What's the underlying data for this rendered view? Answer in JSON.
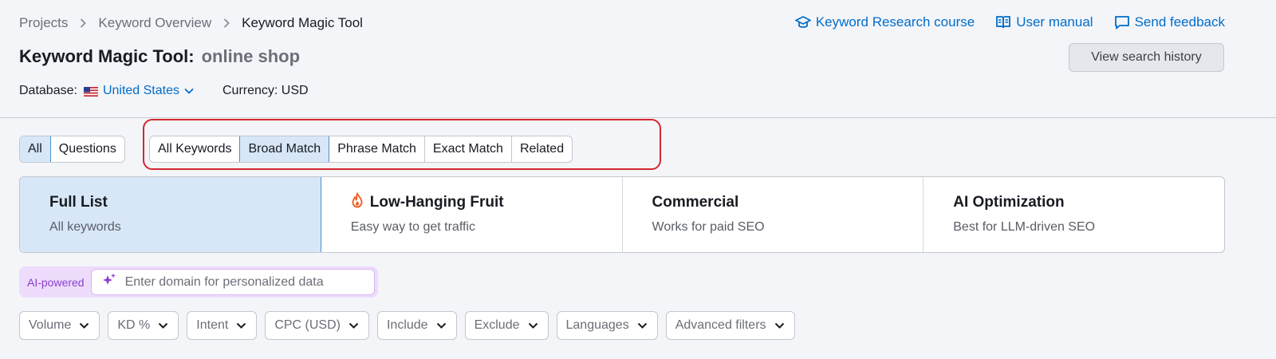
{
  "breadcrumb": [
    "Projects",
    "Keyword Overview",
    "Keyword Magic Tool"
  ],
  "top_links": {
    "course": "Keyword Research course",
    "manual": "User manual",
    "feedback": "Send feedback"
  },
  "title": {
    "tool": "Keyword Magic Tool:",
    "query": "online shop"
  },
  "history_button": "View search history",
  "database": {
    "label": "Database:",
    "value": "United States"
  },
  "currency": "Currency: USD",
  "scope_tabs": [
    {
      "label": "All",
      "active": true
    },
    {
      "label": "Questions",
      "active": false
    }
  ],
  "match_tabs": [
    {
      "label": "All Keywords",
      "active": false
    },
    {
      "label": "Broad Match",
      "active": true
    },
    {
      "label": "Phrase Match",
      "active": false
    },
    {
      "label": "Exact Match",
      "active": false
    },
    {
      "label": "Related",
      "active": false
    }
  ],
  "cards": [
    {
      "title": "Full List",
      "subtitle": "All keywords",
      "active": true,
      "icon": ""
    },
    {
      "title": "Low-Hanging Fruit",
      "subtitle": "Easy way to get traffic",
      "active": false,
      "icon": "flame-icon"
    },
    {
      "title": "Commercial",
      "subtitle": "Works for paid SEO",
      "active": false,
      "icon": ""
    },
    {
      "title": "AI Optimization",
      "subtitle": "Best for LLM-driven SEO",
      "active": false,
      "icon": ""
    }
  ],
  "ai_box": {
    "label": "AI-powered",
    "placeholder": "Enter domain for personalized data"
  },
  "filters": [
    "Volume",
    "KD %",
    "Intent",
    "CPC (USD)",
    "Include",
    "Exclude",
    "Languages",
    "Advanced filters"
  ],
  "colors": {
    "accent_blue": "#006dca",
    "active_bg": "#d7e7f7",
    "highlight_red": "#d3282e",
    "ai_purple": "#8a3fcf",
    "flame_orange": "#f0622a"
  }
}
